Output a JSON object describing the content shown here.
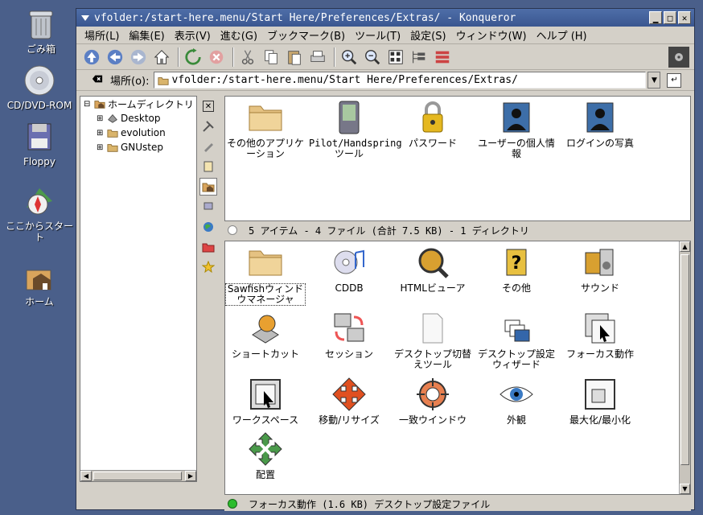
{
  "desktop": {
    "icons": [
      {
        "label": "ごみ箱",
        "icon": "trash-icon"
      },
      {
        "label": "CD/DVD-ROM",
        "icon": "cdrom-icon"
      },
      {
        "label": "Floppy",
        "icon": "floppy-icon"
      },
      {
        "label": "ここからスタート",
        "icon": "start-here-icon"
      },
      {
        "label": "ホーム",
        "icon": "home-icon"
      }
    ]
  },
  "window": {
    "title": "vfolder:/start-here.menu/Start Here/Preferences/Extras/ - Konqueror",
    "controls": {
      "minimize": "▁",
      "maximize": "□",
      "close": "✕"
    }
  },
  "menubar": [
    "場所(L)",
    "編集(E)",
    "表示(V)",
    "進む(G)",
    "ブックマーク(B)",
    "ツール(T)",
    "設定(S)",
    "ウィンドウ(W)",
    "ヘルプ (H)"
  ],
  "location": {
    "label": "場所(o):",
    "value": "vfolder:/start-here.menu/Start Here/Preferences/Extras/"
  },
  "tree": {
    "root": "ホームディレクトリ",
    "children": [
      "Desktop",
      "evolution",
      "GNUstep"
    ]
  },
  "top_pane": {
    "items": [
      {
        "label": "その他のアプリケーション",
        "icon": "folder-icon"
      },
      {
        "label": "Pilot/Handspringツール",
        "icon": "pda-icon"
      },
      {
        "label": "パスワード",
        "icon": "lock-icon"
      },
      {
        "label": "ユーザーの個人情報",
        "icon": "user-info-icon"
      },
      {
        "label": "ログインの写真",
        "icon": "login-photo-icon"
      }
    ],
    "status": "5 アイテム - 4 ファイル (合計 7.5 KB) - 1 ディレクトリ"
  },
  "bottom_pane": {
    "items": [
      {
        "label": "Sawfishウィンドウマネージャ",
        "icon": "folder-icon"
      },
      {
        "label": "CDDB",
        "icon": "cddb-icon"
      },
      {
        "label": "HTMLビューア",
        "icon": "html-viewer-icon"
      },
      {
        "label": "その他",
        "icon": "misc-icon"
      },
      {
        "label": "サウンド",
        "icon": "sound-icon"
      },
      {
        "label": "ショートカット",
        "icon": "shortcut-icon"
      },
      {
        "label": "セッション",
        "icon": "session-icon"
      },
      {
        "label": "デスクトップ切替えツール",
        "icon": "desktop-switch-icon"
      },
      {
        "label": "デスクトップ設定ウィザード",
        "icon": "desktop-wizard-icon"
      },
      {
        "label": "フォーカス動作",
        "icon": "focus-icon"
      },
      {
        "label": "ワークスペース",
        "icon": "workspace-icon"
      },
      {
        "label": "移動/リサイズ",
        "icon": "move-resize-icon"
      },
      {
        "label": "一致ウインドウ",
        "icon": "match-window-icon"
      },
      {
        "label": "外観",
        "icon": "eye-icon"
      },
      {
        "label": "最大化/最小化",
        "icon": "maximize-icon"
      },
      {
        "label": "配置",
        "icon": "placement-icon"
      }
    ],
    "status": "フォーカス動作 (1.6 KB)  デスクトップ設定ファイル"
  },
  "colors": {
    "desktop": "#4a5f8a",
    "title": "#3a5690",
    "folder": "#d9b46b"
  }
}
